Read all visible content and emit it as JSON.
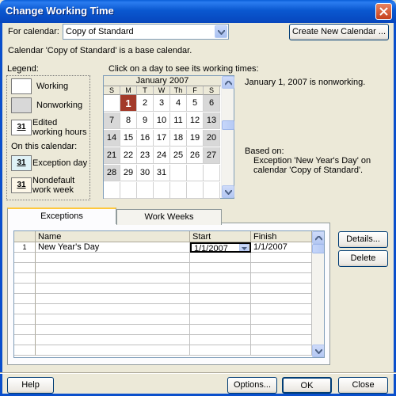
{
  "window": {
    "title": "Change Working Time"
  },
  "for_calendar": {
    "label": "For calendar:",
    "value": "Copy of Standard"
  },
  "create_new_calendar_label": "Create New Calendar ...",
  "base_calendar_text": "Calendar 'Copy of Standard' is a base calendar.",
  "legend": {
    "title": "Legend:",
    "items": [
      {
        "label": "Working"
      },
      {
        "label": "Nonworking"
      },
      {
        "label": "Edited working hours",
        "glyph": "31"
      }
    ],
    "on_this_calendar": "On this calendar:",
    "calendar_items": [
      {
        "label": "Exception day",
        "glyph": "31"
      },
      {
        "label": "Nondefault work week",
        "glyph": "31"
      }
    ]
  },
  "calendar": {
    "instruction": "Click on a day to see its working times:",
    "month": "January 2007",
    "days_of_week": [
      "S",
      "M",
      "T",
      "W",
      "Th",
      "F",
      "S"
    ],
    "weeks": [
      [
        "",
        "1",
        "2",
        "3",
        "4",
        "5",
        "6"
      ],
      [
        "7",
        "8",
        "9",
        "10",
        "11",
        "12",
        "13"
      ],
      [
        "14",
        "15",
        "16",
        "17",
        "18",
        "19",
        "20"
      ],
      [
        "21",
        "22",
        "23",
        "24",
        "25",
        "26",
        "27"
      ],
      [
        "28",
        "29",
        "30",
        "31",
        "",
        "",
        ""
      ],
      [
        "",
        "",
        "",
        "",
        "",
        "",
        ""
      ]
    ],
    "selected_day": "1"
  },
  "info": {
    "day_status": "January 1, 2007 is nonworking.",
    "based_on_label": "Based on:",
    "based_on_text": "Exception 'New Year's Day' on calendar 'Copy of Standard'."
  },
  "tabs": [
    {
      "label": "Exceptions",
      "active": true
    },
    {
      "label": "Work Weeks",
      "active": false
    }
  ],
  "exceptions_table": {
    "columns": [
      "Name",
      "Start",
      "Finish"
    ],
    "rows": [
      {
        "id": "1",
        "name": "New Year's Day",
        "start": "1/1/2007",
        "finish": "1/1/2007"
      }
    ]
  },
  "side_buttons": {
    "details": "Details...",
    "delete": "Delete"
  },
  "footer": {
    "help": "Help",
    "options": "Options...",
    "ok": "OK",
    "close": "Close"
  }
}
